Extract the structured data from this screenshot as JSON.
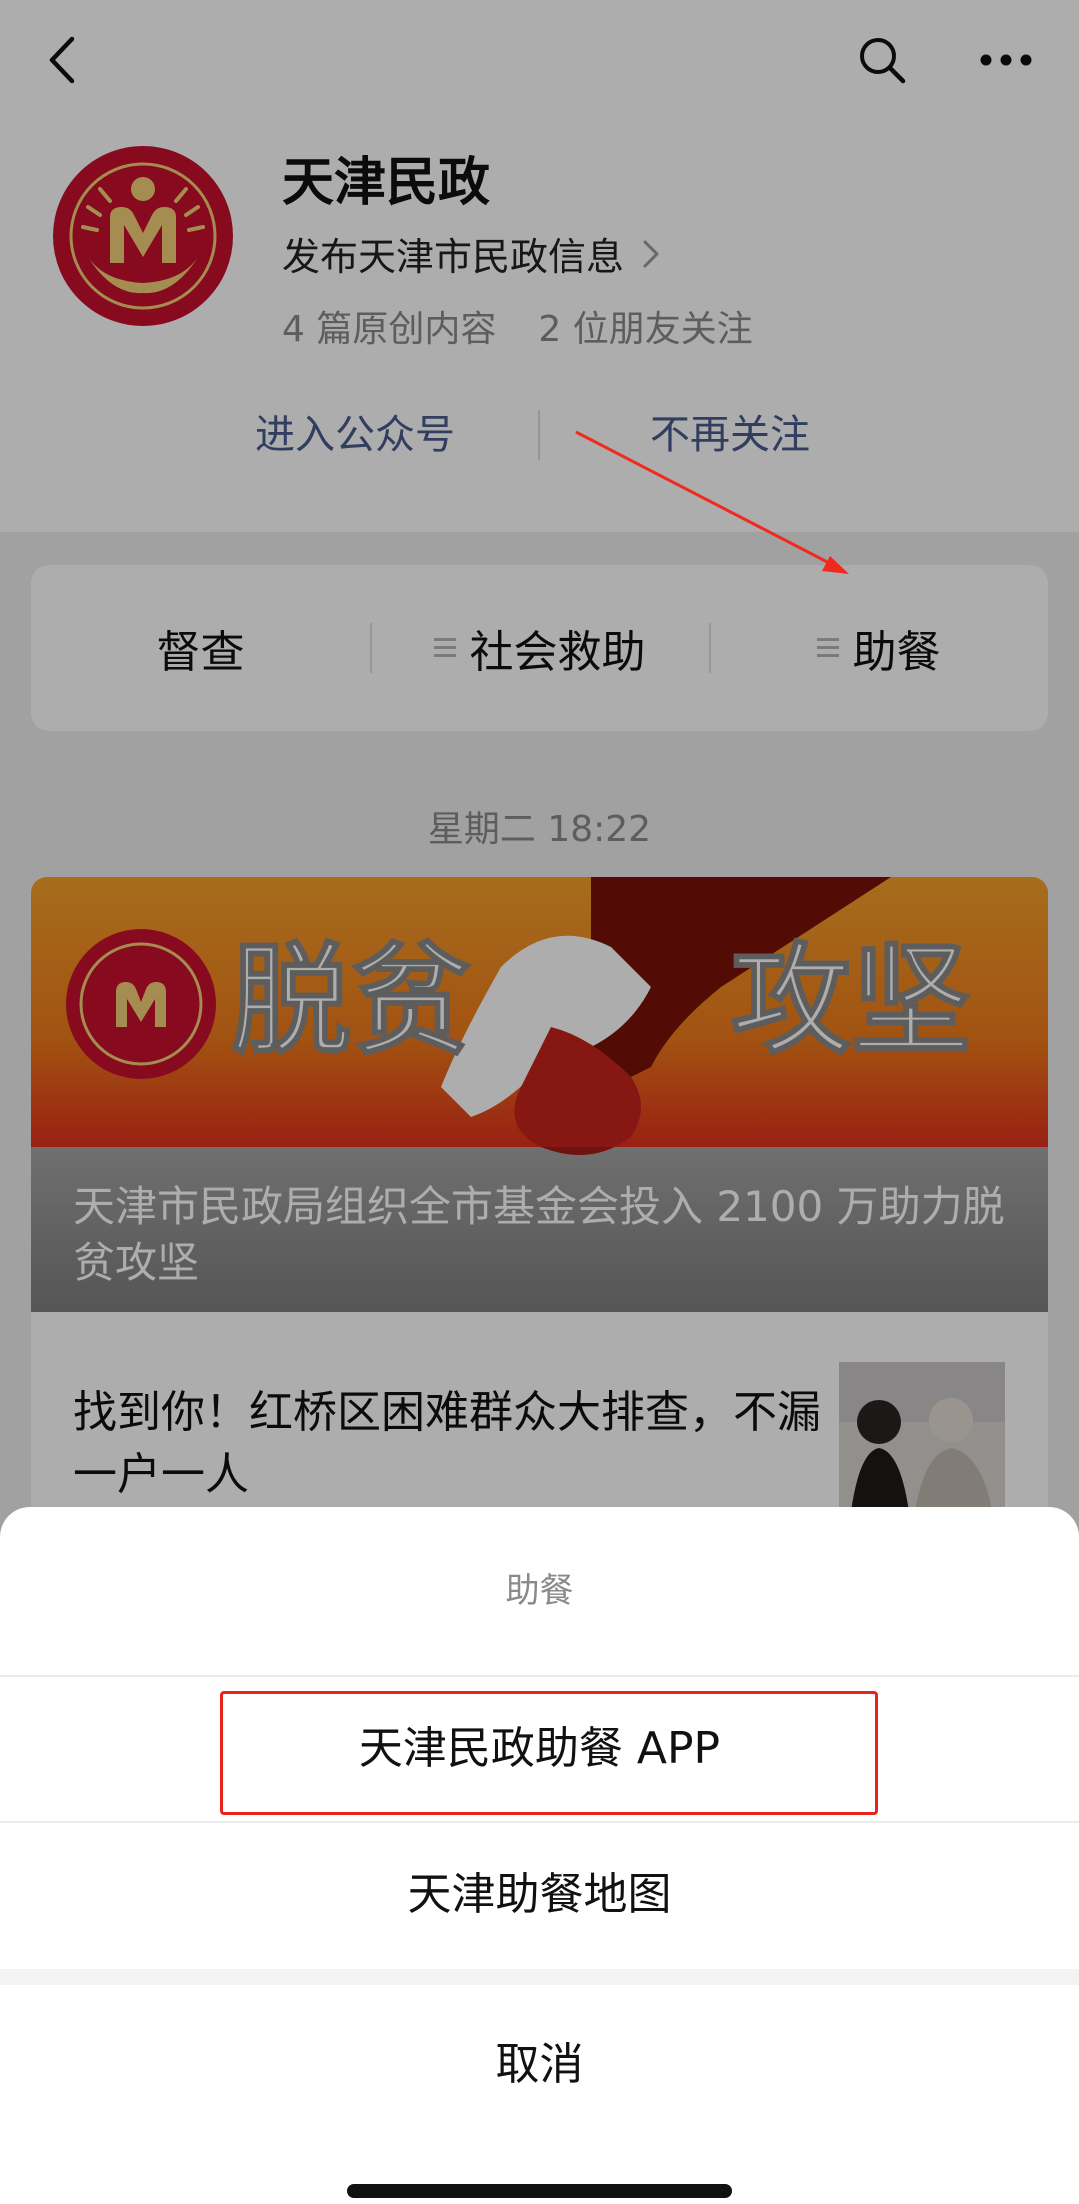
{
  "account": {
    "name": "天津民政",
    "description": "发布天津市民政信息",
    "stats": [
      "4 篇原创内容",
      "2 位朋友关注"
    ]
  },
  "actions": {
    "enter": "进入公众号",
    "unfollow": "不再关注"
  },
  "menu": {
    "items": [
      {
        "label": "督查"
      },
      {
        "label": "社会救助"
      },
      {
        "label": "助餐"
      }
    ]
  },
  "feed": {
    "timestamp": "星期二 18:22",
    "banner_text_left": "脱贫",
    "banner_text_right": "攻坚",
    "lead_title": "天津市民政局组织全市基金会投入 2100 万助力脱贫攻坚",
    "second_title": "找到你！红桥区困难群众大排查，不漏一户一人"
  },
  "sheet": {
    "title": "助餐",
    "options": [
      "天津民政助餐 APP",
      "天津助餐地图"
    ],
    "cancel": "取消"
  },
  "icons": {
    "back": "chevron-left-icon",
    "search": "search-icon",
    "more": "more-dots-icon",
    "menu": "menu-lines-icon",
    "chevron": "chevron-right-icon"
  },
  "colors": {
    "link": "#4a5c8c",
    "highlight": "#e8231c",
    "logo_red": "#c8102e",
    "logo_gold": "#e0a020"
  }
}
